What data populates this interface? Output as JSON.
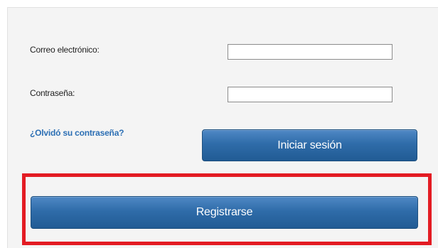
{
  "login_form": {
    "email_label": "Correo electrónico:",
    "email_value": "",
    "password_label": "Contraseña:",
    "password_value": "",
    "forgot_password_link": "¿Olvidó su contraseña?",
    "login_button": "Iniciar sesión",
    "register_button": "Registrarse"
  },
  "colors": {
    "button_blue": "#2f6ca9",
    "link_blue": "#2c6fb4",
    "highlight_red": "#e31b23",
    "panel_bg": "#f4f4f4"
  }
}
